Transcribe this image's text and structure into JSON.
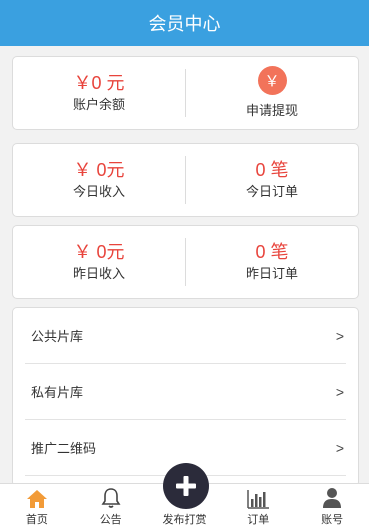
{
  "header": {
    "title": "会员中心"
  },
  "balance_card": {
    "amount": "￥0 元",
    "amount_label": "账户余额",
    "withdraw_icon": "￥",
    "withdraw_label": "申请提现"
  },
  "today_card": {
    "income": "￥ 0元",
    "income_label": "今日收入",
    "orders": "0 笔",
    "orders_label": "今日订单"
  },
  "yesterday_card": {
    "income": "￥ 0元",
    "income_label": "昨日收入",
    "orders": "0 笔",
    "orders_label": "昨日订单"
  },
  "menu": {
    "items": [
      {
        "label": "公共片库",
        "chevron": ">"
      },
      {
        "label": "私有片库",
        "chevron": ">"
      },
      {
        "label": "推广二维码",
        "chevron": ">"
      }
    ]
  },
  "tabbar": {
    "tabs": [
      {
        "label": "首页",
        "icon": "home-icon",
        "active": true
      },
      {
        "label": "公告",
        "icon": "bell-icon"
      },
      {
        "label": "发布打赏",
        "icon": "plus-icon"
      },
      {
        "label": "订单",
        "icon": "bar-chart-icon"
      },
      {
        "label": "账号",
        "icon": "user-icon"
      }
    ]
  },
  "colors": {
    "header": "#3aa0e0",
    "amount": "#e8443c",
    "withdraw_circle": "#f2735a",
    "home_active": "#f29b38",
    "publish_button": "#2b2b3a"
  }
}
